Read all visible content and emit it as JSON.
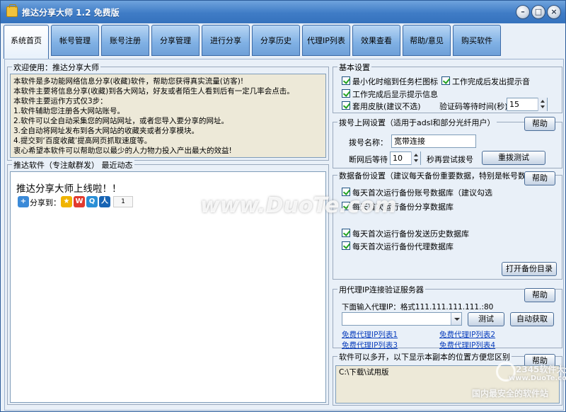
{
  "window": {
    "title": "推达分享大师 1.2 免费版",
    "controls": [
      "minimize",
      "maximize",
      "close"
    ]
  },
  "tabs": [
    {
      "label": "系统首页",
      "active": true
    },
    {
      "label": "帐号管理",
      "active": false
    },
    {
      "label": "账号注册",
      "active": false
    },
    {
      "label": "分享管理",
      "active": false
    },
    {
      "label": "进行分享",
      "active": false
    },
    {
      "label": "分享历史",
      "active": false
    },
    {
      "label": "代理IP列表",
      "active": false
    },
    {
      "label": "效果查看",
      "active": false
    },
    {
      "label": "帮助/意见",
      "active": false
    },
    {
      "label": "购买软件",
      "active": false
    }
  ],
  "welcome": {
    "label": "欢迎使用：推达分享大师",
    "lines": [
      "本软件是多功能网络信息分享(收藏)软件，帮助您获得真实流量(访客)!",
      "本软件主要将信息分享(收藏)到各大网站，好友或者陌生人看到后有一定几率会点击。",
      "本软件主要运作方式仅3步：",
      "1.软件辅助您注册各大网站账号。",
      "2.软件可以全自动采集您的网站网址，或者您导入要分享的网址。",
      "3.全自动将网址发布到各大网站的收藏夹或者分享模块。",
      "4.提交到‘百度收藏’提高网页抓取速度等。",
      "衷心希望本软件可以帮助您以最少的人力物力投入产出最大的效益!"
    ]
  },
  "news": {
    "label": "推达软件（专注献群发） 最近动态",
    "headline": "推达分享大师上线啦！！",
    "share_label": "分享到：",
    "share_count": "1",
    "share_icons": [
      "share-plus-icon",
      "qzone-icon",
      "weibo-icon",
      "tencent-weibo-icon",
      "renren-icon"
    ]
  },
  "basic": {
    "label": "基本设置",
    "min_tray": {
      "label": "最小化时缩到任务栏图标",
      "checked": true
    },
    "done_sound": {
      "label": "工作完成后发出提示音",
      "checked": true
    },
    "done_msg": {
      "label": "工作完成后显示提示信息",
      "checked": true
    },
    "skin": {
      "label": "套用皮肤(建议不选)",
      "checked": true
    },
    "captcha_label": "验证码等待时间(秒)",
    "captcha_value": "15"
  },
  "dial": {
    "label": "拨号上网设置（适用于adsl和部分光纤用户）",
    "help": "帮助",
    "name_label": "拨号名称：",
    "name_value": "宽带连接",
    "wait_label": "断网后等待",
    "wait_value": "10",
    "retry_label": "秒再尝试拨号",
    "test_button": "重拨测试"
  },
  "backup": {
    "label": "数据备份设置（建议每天备份重要数据，特别是帐号数据）",
    "help": "帮助",
    "items": [
      {
        "label": "每天首次运行备份账号数据库（建议勾选",
        "checked": true
      },
      {
        "label": "每天首次运行备份分享数据库",
        "checked": true
      },
      {
        "label": "每天首次运行备份发送历史数据库",
        "checked": true
      },
      {
        "label": "每天首次运行备份代理数据库",
        "checked": true
      }
    ],
    "open_dir": "打开备份目录"
  },
  "proxy": {
    "label": "用代理IP连接验证服务器",
    "help": "帮助",
    "hint": "下面输入代理IP：格式111.111.111.111.:80",
    "input_value": "",
    "test_button": "测试",
    "auto_button": "自动获取",
    "links": [
      "免费代理IP列表1",
      "免费代理IP列表2",
      "免费代理IP列表3",
      "免费代理IP列表4"
    ]
  },
  "multi": {
    "label": "软件可以多开，以下显示本副本的位置方便您区别",
    "help": "帮助",
    "path": "C:\\下载\\试用版"
  },
  "watermarks": {
    "center": "www.DuoTe.com",
    "corner_brand": "2345软件大全",
    "corner_url": "www.DuoTe.com",
    "corner_slogan": "国内最安全的软件站"
  },
  "colors": {
    "title_bar": "#3f7cc6",
    "tab": "#7fb0e4",
    "panel": "#e9f0f8",
    "link": "#0b3fbd",
    "check": "#21a121"
  }
}
